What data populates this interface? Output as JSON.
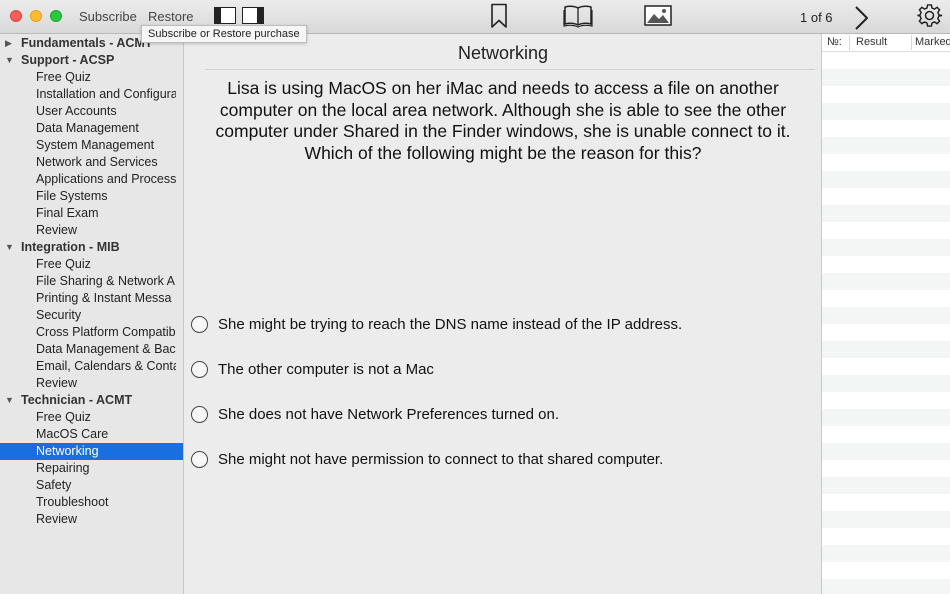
{
  "toolbar": {
    "subscribe_label": "Subscribe",
    "restore_label": "Restore",
    "page_counter": "1 of 6",
    "tooltip": "Subscribe or Restore purchase"
  },
  "sidebar": {
    "groups": [
      {
        "label": "Fundamentals - ACMT",
        "expanded": false,
        "items": []
      },
      {
        "label": "Support - ACSP",
        "expanded": true,
        "items": [
          "Free Quiz",
          "Installation and Configura",
          "User Accounts",
          "Data Management",
          "System Management",
          "Network and Services",
          "Applications and Process",
          "File Systems",
          "Final Exam",
          "Review"
        ]
      },
      {
        "label": "Integration - MIB",
        "expanded": true,
        "items": [
          "Free Quiz",
          "File Sharing & Network A",
          "Printing & Instant Messa",
          "Security",
          "Cross Platform Compatib",
          "Data Management & Bac",
          "Email, Calendars & Conta",
          "Review"
        ]
      },
      {
        "label": "Technician - ACMT",
        "expanded": true,
        "items": [
          "Free Quiz",
          "MacOS Care",
          "Networking",
          "Repairing",
          "Safety",
          "Troubleshoot",
          "Review"
        ]
      }
    ],
    "selected": "Technician - ACMT/Networking"
  },
  "question": {
    "title": "Networking",
    "text": "Lisa is using MacOS on her iMac and needs to access a file on another computer on the local area network. Although she is able to see the other computer under Shared in the Finder windows, she is unable connect to it. Which of the following might be the reason for this?",
    "answers": [
      "She might be trying to reach the DNS name instead of the IP address.",
      "The other computer is not a Mac",
      "She does not have Network Preferences turned on.",
      "She might not have permission to connect to that shared computer."
    ]
  },
  "results": {
    "columns": {
      "num": "№:",
      "result": "Result",
      "marked": "Marked"
    }
  },
  "colors": {
    "selection": "#1a6fe0",
    "close": "#fd5f57",
    "minimize": "#fdbc2f",
    "maximize": "#28c840"
  }
}
